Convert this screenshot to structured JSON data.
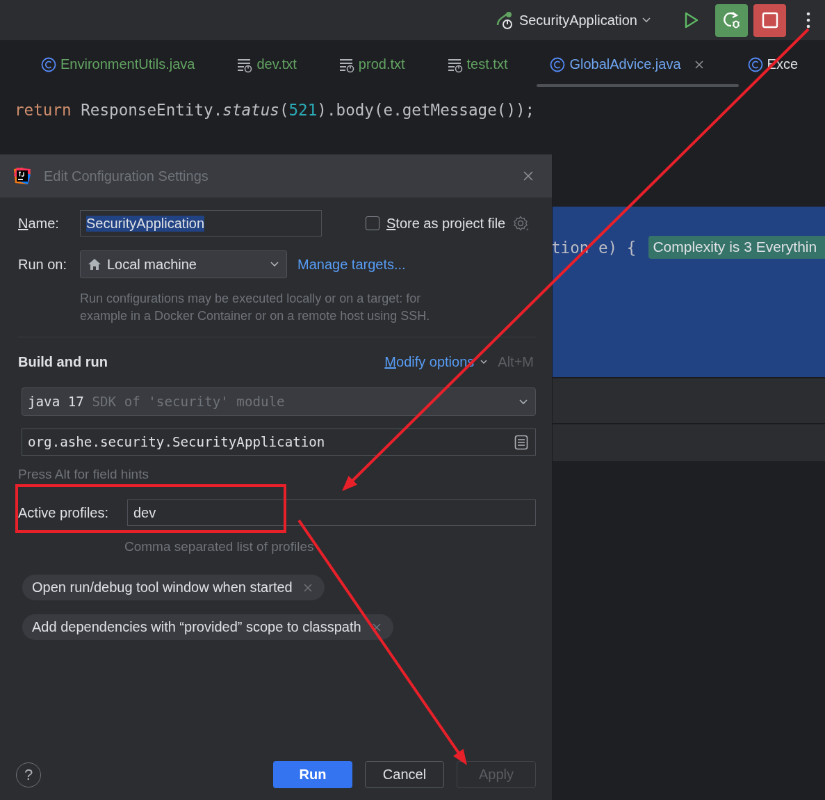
{
  "toolbar": {
    "run_configuration": "SecurityApplication",
    "buttons": [
      {
        "kind": "run"
      },
      {
        "kind": "rerun"
      },
      {
        "kind": "stop"
      },
      {
        "kind": "more"
      }
    ]
  },
  "tabs": [
    {
      "name": "EnvironmentUtils.java",
      "kind": "class",
      "color": "#62a362",
      "selected": false
    },
    {
      "name": "dev.txt",
      "kind": "text",
      "color": "#62a362",
      "selected": false
    },
    {
      "name": "prod.txt",
      "kind": "text",
      "color": "#62a362",
      "selected": false
    },
    {
      "name": "test.txt",
      "kind": "text",
      "color": "#62a362",
      "selected": false
    },
    {
      "name": "GlobalAdvice.java",
      "kind": "class",
      "color": "#6fa4f0",
      "selected": true
    },
    {
      "name": "Exce",
      "kind": "class",
      "color": "#dfe1e5",
      "selected": false
    }
  ],
  "code": {
    "line": [
      {
        "text": "return",
        "kind": "keyword"
      },
      {
        "text": " ResponseEntity.",
        "kind": "plain"
      },
      {
        "text": "status",
        "kind": "italic"
      },
      {
        "text": "(",
        "kind": "plain"
      },
      {
        "text": "521",
        "kind": "number"
      },
      {
        "text": ").body(e.getMessage());",
        "kind": "plain"
      }
    ],
    "selected_line": "tion e) {",
    "inlay_hint": "Complexity is 3 Everythin"
  },
  "dialog": {
    "title": "Edit Configuration Settings",
    "show_mnemonics": true,
    "name_label": "Name:",
    "name_value": "SecurityApplication",
    "name_value_selected": true,
    "store_checkbox": {
      "label": "Store as project file",
      "checked": false
    },
    "run_on_label": "Run on:",
    "run_on_value": "Local machine",
    "manage_targets": "Manage targets...",
    "run_on_hint": "Run configurations may be executed locally or on a target: for example in a Docker Container or on a remote host using SSH.",
    "section_title": "Build and run",
    "modify_options": "Modify options",
    "modify_shortcut": "Alt+M",
    "jdk": {
      "value": "java 17",
      "detail": "SDK of 'security' module"
    },
    "main_class": "org.ashe.security.SecurityApplication",
    "field_hint": "Press Alt for field hints",
    "active_profiles_label": "Active profiles:",
    "active_profiles_value": "dev",
    "active_profiles_hint": "Comma separated list of profiles",
    "options": [
      "Open run/debug tool window when started",
      "Add dependencies with “provided” scope to classpath"
    ],
    "help": "?",
    "buttons": [
      {
        "label": "Run",
        "kind": "primary",
        "disabled": false
      },
      {
        "label": "Cancel",
        "kind": "normal",
        "disabled": false
      },
      {
        "label": "Apply",
        "kind": "normal",
        "disabled": true
      }
    ]
  },
  "annotations": [
    {
      "kind": "arrow"
    },
    {
      "kind": "frame"
    },
    {
      "kind": "arrow"
    }
  ]
}
